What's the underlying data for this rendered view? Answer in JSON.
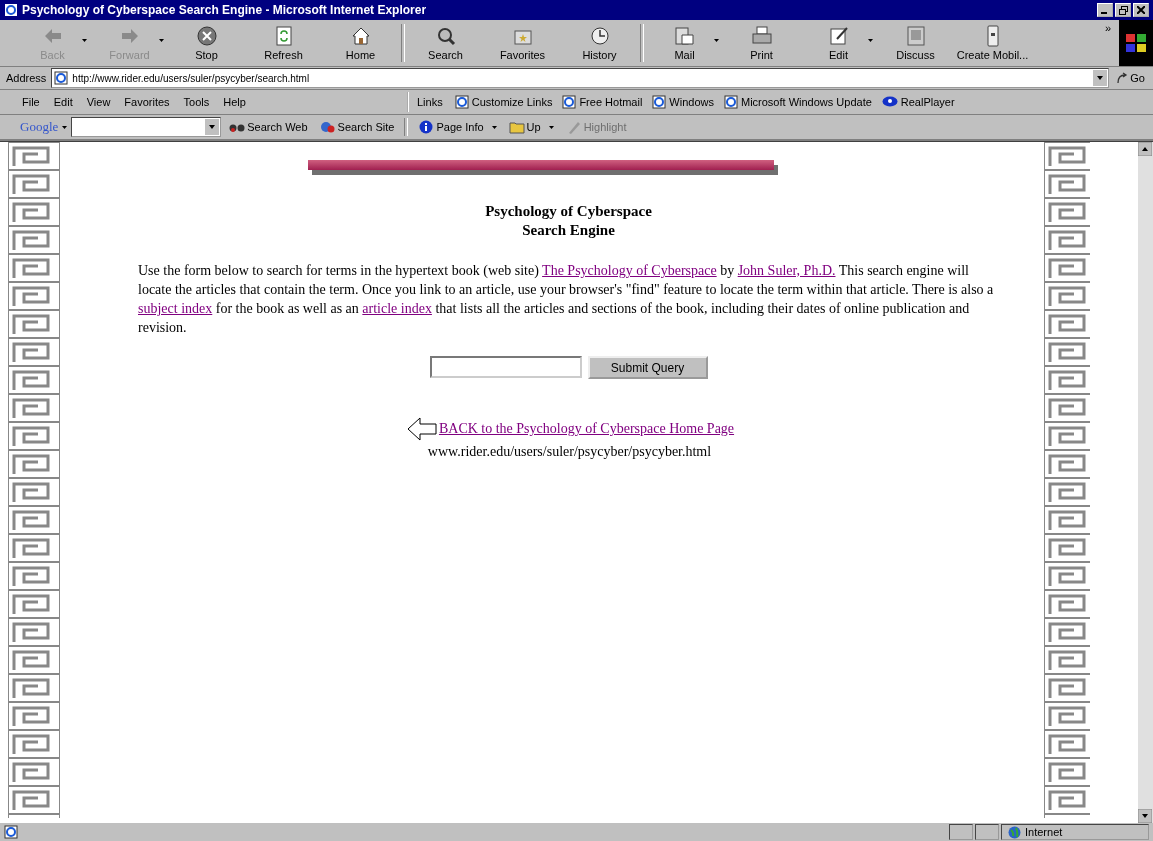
{
  "window": {
    "title": "Psychology of Cyberspace Search Engine - Microsoft Internet Explorer"
  },
  "toolbar": [
    {
      "label": "Back",
      "disabled": true,
      "dropdown": true
    },
    {
      "label": "Forward",
      "disabled": true,
      "dropdown": true
    },
    {
      "label": "Stop",
      "disabled": false,
      "dropdown": false
    },
    {
      "label": "Refresh",
      "disabled": false,
      "dropdown": false
    },
    {
      "label": "Home",
      "disabled": false,
      "dropdown": false
    },
    {
      "label": "Search",
      "disabled": false,
      "dropdown": false
    },
    {
      "label": "Favorites",
      "disabled": false,
      "dropdown": false
    },
    {
      "label": "History",
      "disabled": false,
      "dropdown": false
    },
    {
      "label": "Mail",
      "disabled": false,
      "dropdown": true
    },
    {
      "label": "Print",
      "disabled": false,
      "dropdown": false
    },
    {
      "label": "Edit",
      "disabled": false,
      "dropdown": true
    },
    {
      "label": "Discuss",
      "disabled": false,
      "dropdown": false
    },
    {
      "label": "Create Mobil...",
      "disabled": false,
      "dropdown": false
    }
  ],
  "toolbar_more": "»",
  "address_bar": {
    "label": "Address",
    "value": "http://www.rider.edu/users/suler/psycyber/search.html",
    "go": "Go"
  },
  "menu": [
    "File",
    "Edit",
    "View",
    "Favorites",
    "Tools",
    "Help"
  ],
  "links_bar": {
    "label": "Links",
    "items": [
      "Customize Links",
      "Free Hotmail",
      "Windows",
      "Microsoft Windows Update",
      "RealPlayer"
    ]
  },
  "google_bar": {
    "logo": "Google",
    "items": [
      {
        "label": "Search Web",
        "disabled": false
      },
      {
        "label": "Search Site",
        "disabled": false
      },
      {
        "label": "Page Info",
        "disabled": false
      },
      {
        "label": "Up",
        "disabled": false
      },
      {
        "label": "Highlight",
        "disabled": true
      }
    ]
  },
  "page": {
    "heading": [
      "Psychology of Cyberspace",
      "Search Engine"
    ],
    "intro": [
      {
        "kind": "text",
        "text": "Use the form below to search for terms in the hypertext book (web site) "
      },
      {
        "kind": "link",
        "text": "The Psychology of Cyberspace"
      },
      {
        "kind": "text",
        "text": " by "
      },
      {
        "kind": "link",
        "text": "John Suler, Ph.D."
      },
      {
        "kind": "text",
        "text": " This search engine will locate the articles that contain the term. Once you link to an article, use your browser's \"find\" feature to locate the term within that article. There is also a "
      },
      {
        "kind": "link",
        "text": "subject index"
      },
      {
        "kind": "text",
        "text": " for the book as well as an "
      },
      {
        "kind": "link",
        "text": "article index"
      },
      {
        "kind": "text",
        "text": " that lists all the articles and sections of the book, including their dates of online publication and revision."
      }
    ],
    "submit": "Submit Query",
    "back_link": "BACK to the Psychology of Cyberspace Home Page",
    "back_url": "www.rider.edu/users/suler/psycyber/psycyber.html"
  },
  "status_bar": {
    "zone": "Internet"
  }
}
